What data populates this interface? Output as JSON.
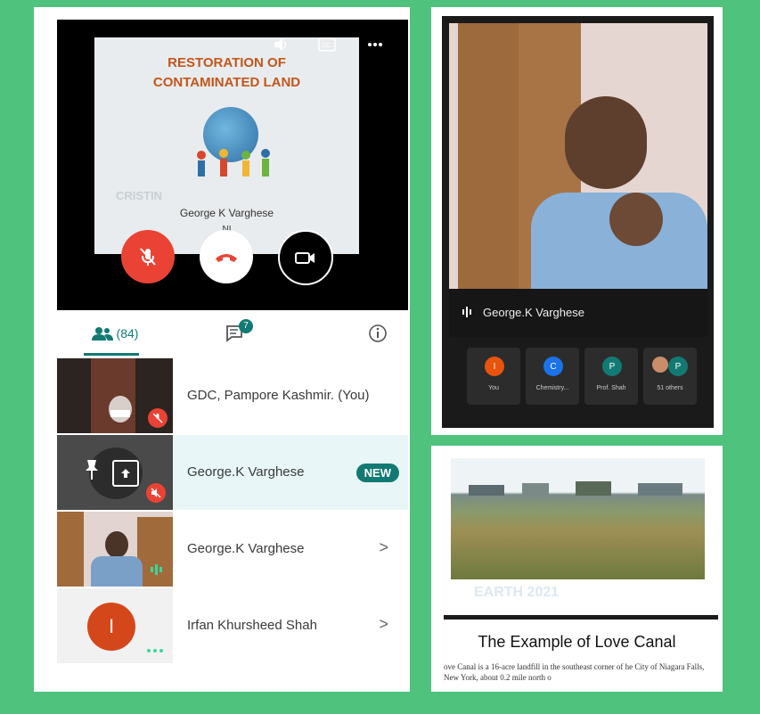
{
  "left": {
    "presenter": {
      "slide_title_line1": "RESTORATION OF",
      "slide_title_line2": "CONTAMINATED LAND",
      "slide_author": "George K Varghese",
      "slide_sub": "NI",
      "slide_mark": "CRISTIN"
    },
    "controls": {
      "mic_state": "muted",
      "video_state": "off"
    },
    "tabs": {
      "people_count": "(84)",
      "chat_badge": "7"
    },
    "participants": [
      {
        "name": "GDC, Pampore Kashmir. (You)"
      },
      {
        "name": "George.K Varghese",
        "badge": "NEW"
      },
      {
        "name": "George.K Varghese",
        "chevron": ">"
      },
      {
        "name": "Irfan Khursheed Shah",
        "avatar_letter": "I",
        "chevron": ">"
      }
    ]
  },
  "right_top": {
    "speaker_name": "George.K Varghese",
    "tiles": [
      {
        "letter": "I",
        "label": "You",
        "color": "#e8530e"
      },
      {
        "letter": "C",
        "label": "Chemistry...",
        "color": "#1a73e8"
      },
      {
        "letter": "P",
        "label": "Prof. Shah",
        "color": "#127a73"
      },
      {
        "letter": "P",
        "label": "51 others",
        "color": "#127a73"
      }
    ]
  },
  "right_bottom": {
    "earth_text": "EARTH 2021",
    "title": "The Example of Love Canal",
    "body": "ove Canal is a 16-acre landfill in the southeast corner of he City of Niagara Falls, New York, about 0.2 mile north o"
  },
  "colors": {
    "teal": "#127a73",
    "red": "#ea4335",
    "bg": "#4fc27e"
  }
}
